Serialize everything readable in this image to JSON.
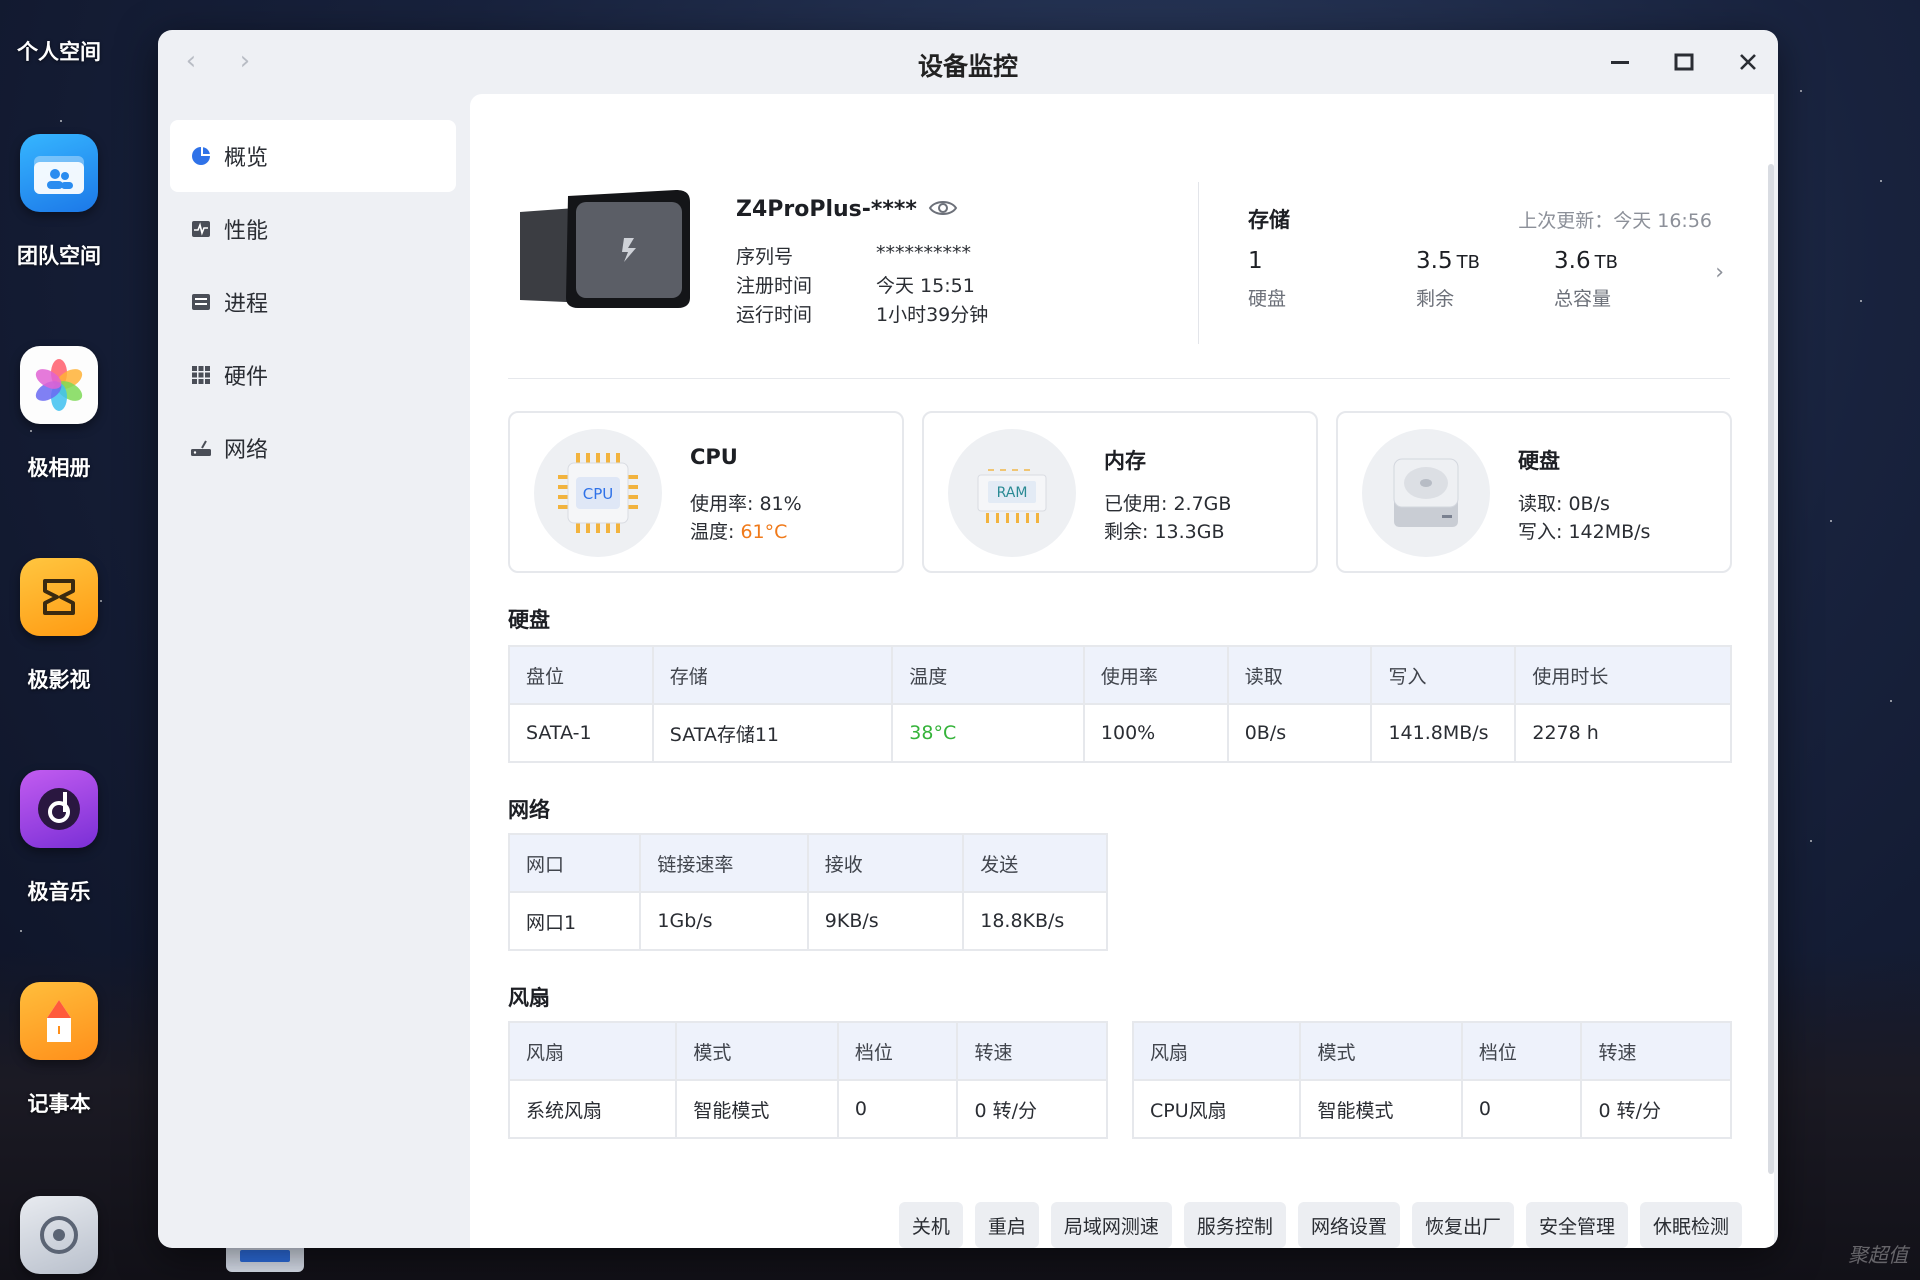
{
  "dock": {
    "top_label": "个人空间",
    "apps": [
      {
        "label": "团队空间",
        "icon": "team-folder-icon"
      },
      {
        "label": "极相册",
        "icon": "photos-flower-icon"
      },
      {
        "label": "极影视",
        "icon": "video-app-icon"
      },
      {
        "label": "极音乐",
        "icon": "music-note-icon"
      },
      {
        "label": "记事本",
        "icon": "notepad-icon"
      },
      {
        "label": "",
        "icon": "settings-app-icon"
      }
    ]
  },
  "window": {
    "title": "设备监控",
    "back_icon": "chevron-left-icon",
    "forward_icon": "chevron-right-icon"
  },
  "sidebar": {
    "items": [
      {
        "label": "概览",
        "icon": "overview-pie-icon",
        "active": true
      },
      {
        "label": "性能",
        "icon": "performance-icon"
      },
      {
        "label": "进程",
        "icon": "process-list-icon"
      },
      {
        "label": "硬件",
        "icon": "hardware-grid-icon"
      },
      {
        "label": "网络",
        "icon": "network-router-icon"
      }
    ]
  },
  "device": {
    "name": "Z4ProPlus-****",
    "rows": [
      {
        "key": "序列号",
        "value": "**********"
      },
      {
        "key": "注册时间",
        "value": "今天 15:51"
      },
      {
        "key": "运行时间",
        "value": "1小时39分钟"
      }
    ]
  },
  "storage": {
    "title": "存储",
    "updated": "上次更新：今天 16:56",
    "stats": [
      {
        "value": "1",
        "unit": "",
        "label": "硬盘"
      },
      {
        "value": "3.5",
        "unit": "TB",
        "label": "剩余"
      },
      {
        "value": "3.6",
        "unit": "TB",
        "label": "总容量"
      }
    ],
    "arrow": "›"
  },
  "cards": {
    "cpu": {
      "title": "CPU",
      "usage": "使用率: 81%",
      "temp_label": "温度: ",
      "temp_value": "61°C",
      "chip_text": "CPU"
    },
    "mem": {
      "title": "内存",
      "used": "已使用: 2.7GB",
      "free": "剩余: 13.3GB",
      "chip_text": "RAM"
    },
    "disk": {
      "title": "硬盘",
      "read": "读取: 0B/s",
      "write": "写入: 142MB/s"
    }
  },
  "disk_table": {
    "title": "硬盘",
    "headers": [
      "盘位",
      "存储",
      "温度",
      "使用率",
      "读取",
      "写入",
      "使用时长"
    ],
    "rows": [
      [
        "SATA-1",
        "SATA存储11",
        "38°C",
        "100%",
        "0B/s",
        "141.8MB/s",
        "2278 h"
      ]
    ]
  },
  "net_table": {
    "title": "网络",
    "headers": [
      "网口",
      "链接速率",
      "接收",
      "发送"
    ],
    "rows": [
      [
        "网口1",
        "1Gb/s",
        "9KB/s",
        "18.8KB/s"
      ]
    ]
  },
  "fan": {
    "title": "风扇",
    "headers": [
      "风扇",
      "模式",
      "档位",
      "转速"
    ],
    "left_rows": [
      [
        "系统风扇",
        "智能模式",
        "0",
        "0 转/分"
      ]
    ],
    "right_rows": [
      [
        "CPU风扇",
        "智能模式",
        "0",
        "0 转/分"
      ]
    ]
  },
  "buttons": [
    "关机",
    "重启",
    "局域网测速",
    "服务控制",
    "网络设置",
    "恢复出厂",
    "安全管理",
    "休眠检测"
  ],
  "watermark": "聚超值",
  "colors": {
    "accent": "#2f72e8",
    "warn": "#f07a1a",
    "ok": "#35b33a",
    "header_bg": "#eef2fb"
  }
}
